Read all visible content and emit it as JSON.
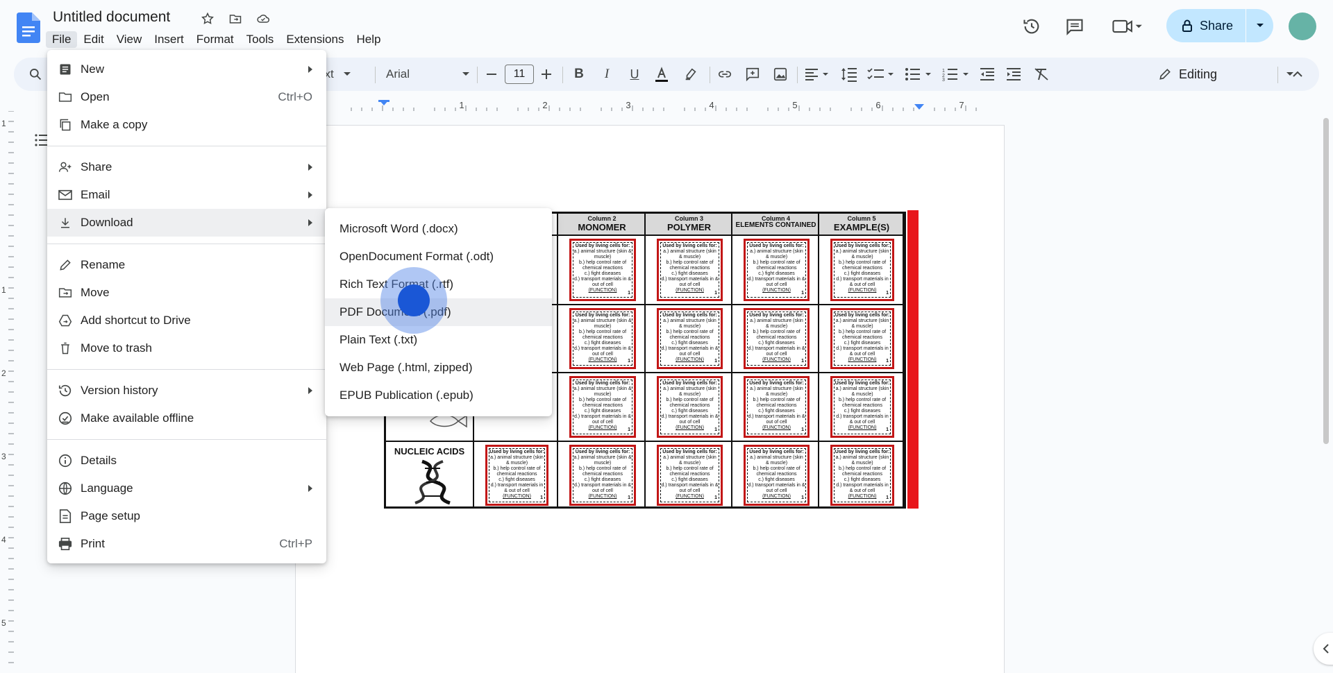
{
  "document": {
    "title": "Untitled document"
  },
  "menubar": [
    "File",
    "Edit",
    "View",
    "Insert",
    "Format",
    "Tools",
    "Extensions",
    "Help"
  ],
  "header": {
    "share_label": "Share"
  },
  "toolbar": {
    "style_label": "ext",
    "font_name": "Arial",
    "font_size": "11",
    "editing_label": "Editing",
    "ruler_numbers": [
      "1",
      "2",
      "3",
      "4",
      "5",
      "6",
      "7"
    ],
    "vruler_numbers": [
      "1",
      "1",
      "2",
      "3",
      "4",
      "5"
    ]
  },
  "file_menu": {
    "items": [
      {
        "label": "New",
        "icon": "document-icon",
        "submenu": true
      },
      {
        "label": "Open",
        "icon": "folder-icon",
        "shortcut": "Ctrl+O"
      },
      {
        "label": "Make a copy",
        "icon": "copy-icon"
      },
      {
        "label": "Share",
        "icon": "person-add-icon",
        "submenu": true
      },
      {
        "label": "Email",
        "icon": "mail-icon",
        "submenu": true
      },
      {
        "label": "Download",
        "icon": "download-icon",
        "submenu": true,
        "highlighted": true
      },
      {
        "label": "Rename",
        "icon": "pencil-icon"
      },
      {
        "label": "Move",
        "icon": "folder-move-icon"
      },
      {
        "label": "Add shortcut to Drive",
        "icon": "drive-shortcut-icon"
      },
      {
        "label": "Move to trash",
        "icon": "trash-icon"
      },
      {
        "label": "Version history",
        "icon": "history-icon",
        "submenu": true
      },
      {
        "label": "Make available offline",
        "icon": "offline-icon"
      },
      {
        "label": "Details",
        "icon": "info-icon"
      },
      {
        "label": "Language",
        "icon": "globe-icon",
        "submenu": true
      },
      {
        "label": "Page setup",
        "icon": "page-setup-icon"
      },
      {
        "label": "Print",
        "icon": "print-icon",
        "shortcut": "Ctrl+P"
      }
    ]
  },
  "download_menu": {
    "items": [
      "Microsoft Word (.docx)",
      "OpenDocument Format (.odt)",
      "Rich Text Format (.rtf)",
      "PDF Document (.pdf)",
      "Plain Text (.txt)",
      "Web Page (.html, zipped)",
      "EPUB Publication (.epub)"
    ],
    "highlighted_index": 3
  },
  "table": {
    "columns": [
      {
        "small": "Column 2",
        "big": "MONOMER"
      },
      {
        "small": "Column 3",
        "big": "POLYMER"
      },
      {
        "small": "Column 4",
        "big": "ELEMENTS CONTAINED"
      },
      {
        "small": "Column 5",
        "big": "EXAMPLE(S)"
      }
    ],
    "row_label": "NUCLEIC ACIDS",
    "card_lines": [
      "Used by living cells for:",
      "a.) animal structure (skin & muscle)",
      "b.) help control rate of chemical reactions",
      "c.) fight diseases",
      "d.) transport materials in & out of cell",
      "(FUNCTION)",
      "1"
    ]
  },
  "colors": {
    "accent": "#0b57d0",
    "share_bg": "#c2e7ff",
    "table_red": "#e8161b"
  }
}
